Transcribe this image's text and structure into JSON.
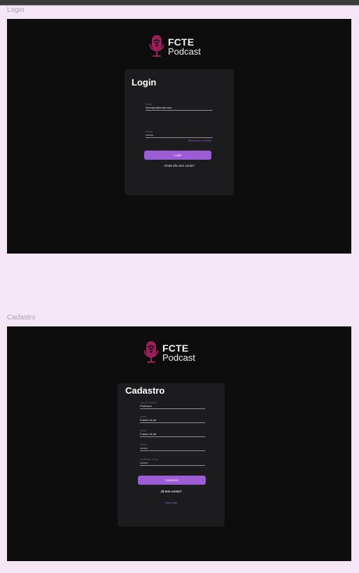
{
  "colors": {
    "accent": "#9b5cd6",
    "brand": "#9c1f5a",
    "frame_bg": "#0d0d0d",
    "card_bg": "#1c1c1e",
    "canvas_bg": "#f5e6f5"
  },
  "brand": {
    "line1": "FCTE",
    "line2": "Podcast",
    "icon": "microphone-logo-icon"
  },
  "login": {
    "frame_label": "Login",
    "title": "Login",
    "email": {
      "label": "Email",
      "value": "exemplo@email.com"
    },
    "password": {
      "label": "Senha",
      "value": "••••••••"
    },
    "forgot_link": "Esqueceu a senha",
    "submit_label": "Login",
    "signup_prompt": "Ainda não tem conta?"
  },
  "cadastro": {
    "frame_label": "Cadastro",
    "title": "Cadastro",
    "fields": [
      {
        "label": "Tipo de usuário",
        "value": "Professor"
      },
      {
        "label": "Nome",
        "value": "Fulano de tal"
      },
      {
        "label": "Email",
        "value": "Fulano de tal"
      },
      {
        "label": "Senha",
        "value": "••••••••"
      },
      {
        "label": "Confirmar senha",
        "value": "••••••••"
      }
    ],
    "submit_label": "Cadastrar",
    "login_prompt": "Já tem conta?",
    "login_link": "Faça login"
  }
}
